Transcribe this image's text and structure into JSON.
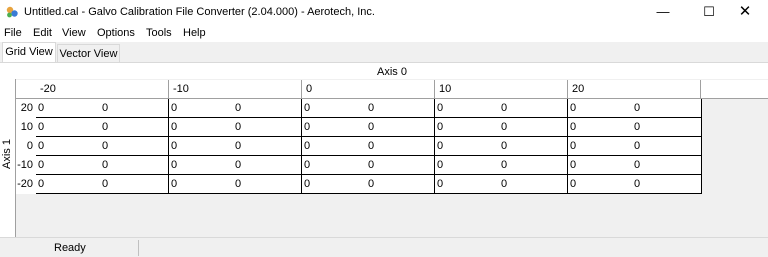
{
  "window": {
    "title": "Untitled.cal - Galvo Calibration File Converter (2.04.000) - Aerotech, Inc.",
    "icon": "galvo-app-icon",
    "min_glyph": "—",
    "max_glyph": "☐",
    "close_glyph": "✕"
  },
  "menu": [
    {
      "label": "File"
    },
    {
      "label": "Edit"
    },
    {
      "label": "View"
    },
    {
      "label": "Options"
    },
    {
      "label": "Tools"
    },
    {
      "label": "Help"
    }
  ],
  "tabs": [
    {
      "label": "Grid View",
      "active": true
    },
    {
      "label": "Vector View",
      "active": false
    }
  ],
  "grid": {
    "axis0_label": "Axis 0",
    "axis1_label": "Axis 1",
    "column_headers": [
      "-20",
      "-10",
      "0",
      "10",
      "20"
    ],
    "row_headers": [
      "20",
      "10",
      "0",
      "-10",
      "-20"
    ],
    "cells": [
      [
        [
          "0",
          "0"
        ],
        [
          "0",
          "0"
        ],
        [
          "0",
          "0"
        ],
        [
          "0",
          "0"
        ],
        [
          "0",
          "0"
        ]
      ],
      [
        [
          "0",
          "0"
        ],
        [
          "0",
          "0"
        ],
        [
          "0",
          "0"
        ],
        [
          "0",
          "0"
        ],
        [
          "0",
          "0"
        ]
      ],
      [
        [
          "0",
          "0"
        ],
        [
          "0",
          "0"
        ],
        [
          "0",
          "0"
        ],
        [
          "0",
          "0"
        ],
        [
          "0",
          "0"
        ]
      ],
      [
        [
          "0",
          "0"
        ],
        [
          "0",
          "0"
        ],
        [
          "0",
          "0"
        ],
        [
          "0",
          "0"
        ],
        [
          "0",
          "0"
        ]
      ],
      [
        [
          "0",
          "0"
        ],
        [
          "0",
          "0"
        ],
        [
          "0",
          "0"
        ],
        [
          "0",
          "0"
        ],
        [
          "0",
          "0"
        ]
      ]
    ]
  },
  "status": {
    "text": "Ready"
  }
}
